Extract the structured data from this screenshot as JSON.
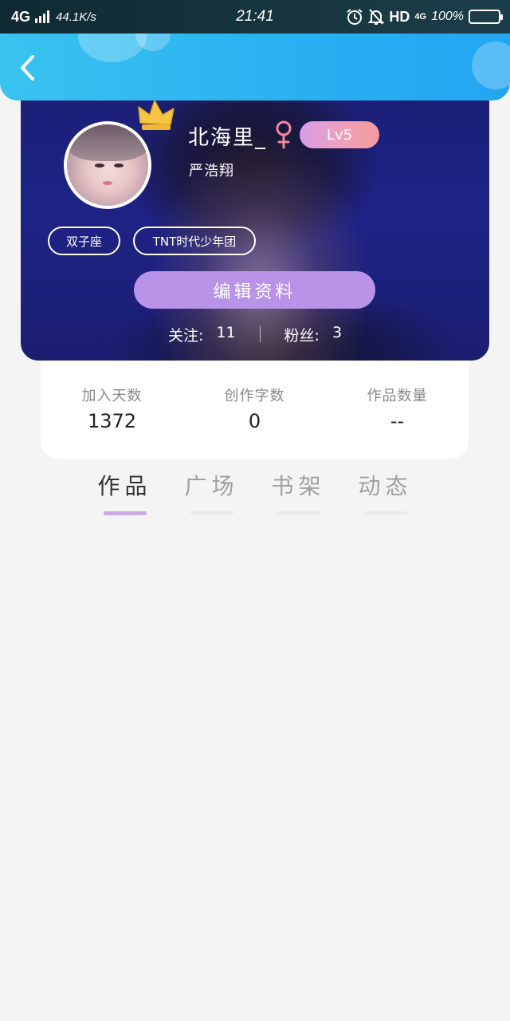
{
  "status_bar": {
    "network": "4G",
    "speed": "44.1K/s",
    "time": "21:41",
    "hd": "HD",
    "sub_network": "4G",
    "battery": "100%"
  },
  "header": {
    "back_icon": "chevron-left-icon"
  },
  "profile": {
    "nickname": "北海里_",
    "gender_icon": "female-icon",
    "level": "Lv5",
    "signature": "严浩翔",
    "tags": [
      "双子座",
      "TNT时代少年团"
    ],
    "edit_label": "编辑资料",
    "following_label": "关注:",
    "following_count": "11",
    "followers_label": "粉丝:",
    "followers_count": "3"
  },
  "stats": [
    {
      "label": "加入天数",
      "value": "1372"
    },
    {
      "label": "创作字数",
      "value": "0"
    },
    {
      "label": "作品数量",
      "value": "--"
    }
  ],
  "tabs": [
    {
      "label": "作品",
      "active": true
    },
    {
      "label": "广场",
      "active": false
    },
    {
      "label": "书架",
      "active": false
    },
    {
      "label": "动态",
      "active": false
    }
  ],
  "colors": {
    "header_gradient_start": "#39c3ef",
    "header_gradient_end": "#23a6f2",
    "edit_button": "#b993e8",
    "level_badge_start": "#d69ee8",
    "level_badge_end": "#f59a9e",
    "active_tab_indicator": "#c9a8e6",
    "gender_icon": "#f08a9c",
    "page_background": "#f4f4f4"
  }
}
